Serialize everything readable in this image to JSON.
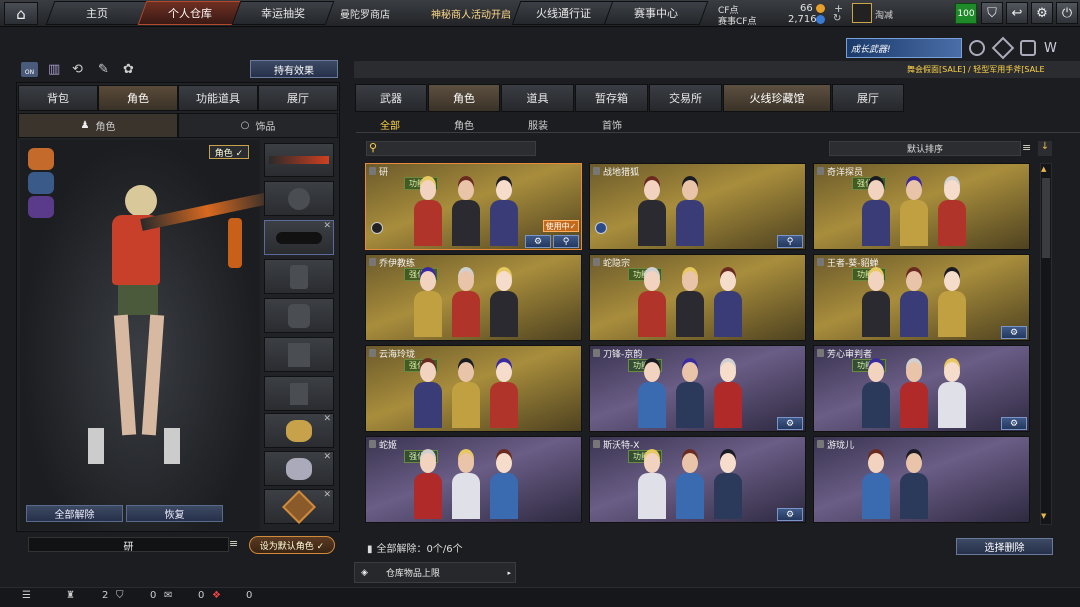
{
  "top": {
    "nav": [
      "主页",
      "个人仓库",
      "幸运抽奖"
    ],
    "shop": "曼陀罗商店",
    "event": "神秘商人活动开启",
    "pass": "火线通行证",
    "match": "赛事中心",
    "cf_label": "CF点",
    "cf_value": "66",
    "cfp_label": "赛事CF点",
    "cfp_value": "2,716",
    "plus": "+",
    "clan": "淘减",
    "level": "100"
  },
  "promo": {
    "banner": "成长武器!",
    "marquee": "舞会假面[SALE] / 轻型军用手斧[SALE"
  },
  "left": {
    "effect_btn": "持有效果",
    "tabs": [
      "背包",
      "角色",
      "功能道具",
      "展厅"
    ],
    "subtabs": [
      "角色",
      "饰品"
    ],
    "role_badge": "角色 ✓",
    "btn_release": "全部解除",
    "btn_restore": "恢复",
    "name_value": "研",
    "btn_default": "设为默认角色 ✓"
  },
  "right": {
    "tabs": [
      "武器",
      "角色",
      "道具",
      "暂存箱",
      "交易所",
      "火线珍藏馆",
      "展厅"
    ],
    "subtabs": [
      "全部",
      "角色",
      "服装",
      "首饰"
    ],
    "search_placeholder": "",
    "sort": "默认排序",
    "footer_release": "全部解除：0个/6个",
    "btn_select_delete": "选择删除",
    "storage_limit": "仓库物品上限"
  },
  "cards": [
    {
      "name": "研",
      "tag": "功能型",
      "theme": "gold",
      "inuse": "使用中✓"
    },
    {
      "name": "战地猎狐",
      "tag": "",
      "theme": "gold"
    },
    {
      "name": "奇洋探员",
      "tag": "强化型",
      "theme": "gold"
    },
    {
      "name": "乔伊教练",
      "tag": "强化型",
      "theme": "gold"
    },
    {
      "name": "蛇隐宗",
      "tag": "功能型",
      "theme": "gold"
    },
    {
      "name": "王者-葵-貂蝉",
      "tag": "功能型",
      "theme": "gold"
    },
    {
      "name": "云海玲珑",
      "tag": "强化型",
      "theme": "gold"
    },
    {
      "name": "刀锋-京韵",
      "tag": "功能型",
      "theme": "purple"
    },
    {
      "name": "芳心审判者",
      "tag": "功能型",
      "theme": "purple"
    },
    {
      "name": "蛇姬",
      "tag": "强化型",
      "theme": "purple"
    },
    {
      "name": "斯沃特-X",
      "tag": "功能型",
      "theme": "purple"
    },
    {
      "name": "游珑儿",
      "tag": "",
      "theme": "purple"
    }
  ],
  "bottom": {
    "c1": "2",
    "c2": "0",
    "c3": "0",
    "c4": "0"
  }
}
